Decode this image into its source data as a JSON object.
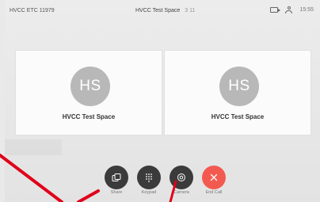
{
  "header": {
    "device_name": "HVCC ETC 11979",
    "call_title": "HVCC Test Space",
    "call_subtitle": "3 11",
    "time": "15:55"
  },
  "participants": [
    {
      "initials": "HS",
      "name": "HVCC Test Space"
    },
    {
      "initials": "HS",
      "name": "HVCC Test Space"
    }
  ],
  "controls": {
    "share": "Share",
    "keypad": "Keypad",
    "camera": "Camera",
    "end_call": "End Call"
  },
  "colors": {
    "end_call": "#f35a4f",
    "control_button": "#3b3b3b",
    "annotation_line": "#e0001a"
  }
}
